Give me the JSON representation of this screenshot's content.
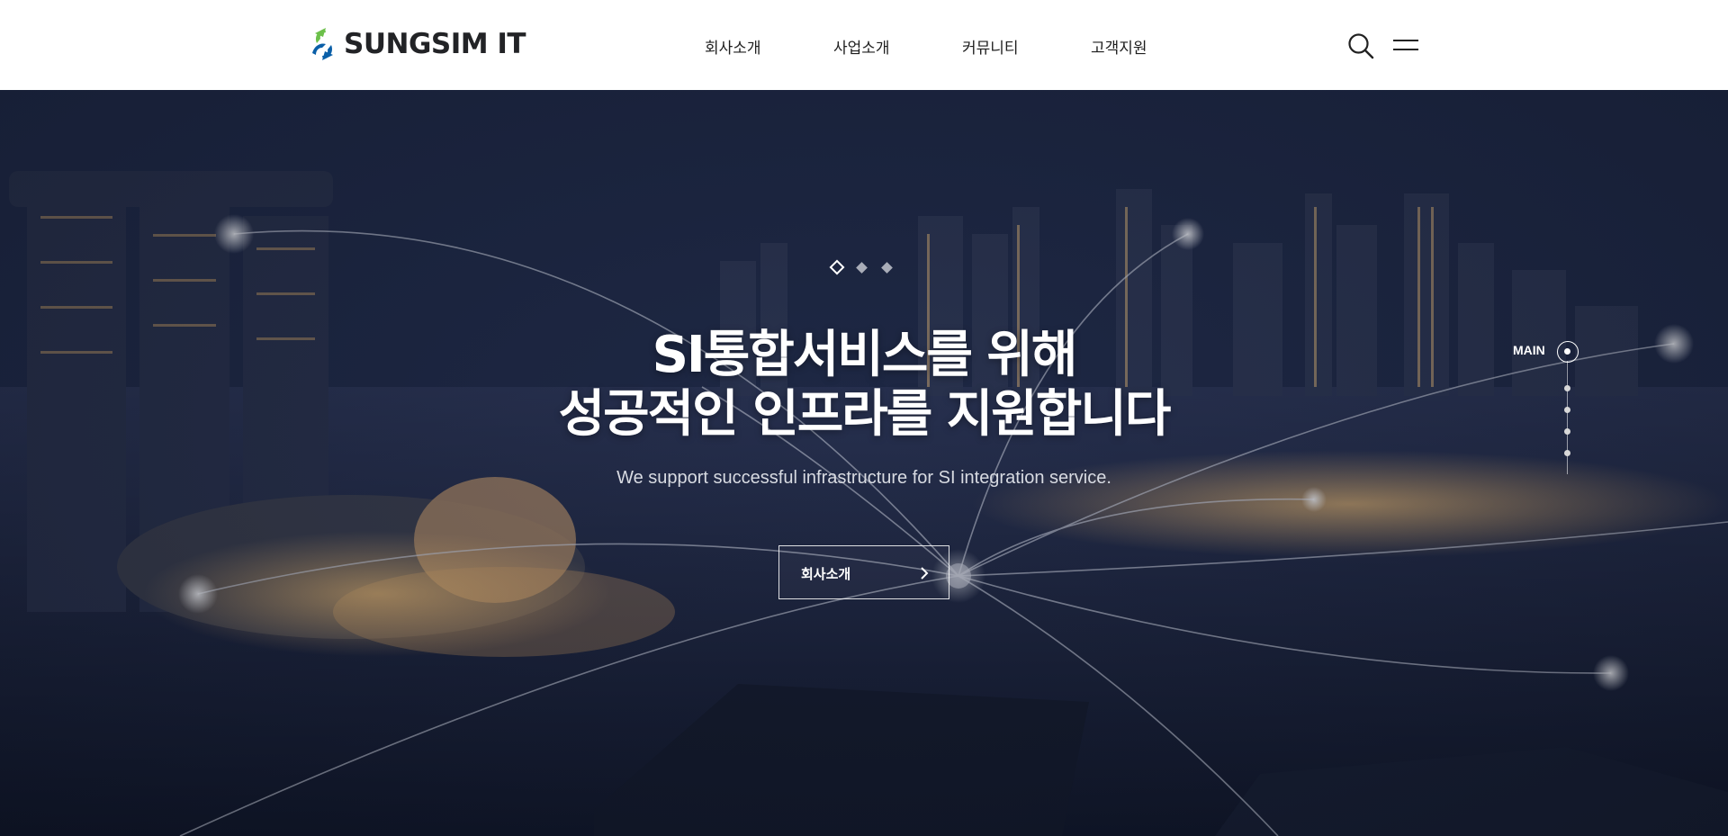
{
  "header": {
    "logo_text": "SUNGSIM IT",
    "nav": [
      "회사소개",
      "사업소개",
      "커뮤니티",
      "고객지원"
    ],
    "search_icon": "search-icon",
    "menu_icon": "hamburger-menu-icon"
  },
  "hero": {
    "title_line1": "SI통합서비스를 위해",
    "title_line2": "성공적인 인프라를 지원합니다",
    "subtitle": "We support successful infrastructure for SI integration service.",
    "cta_label": "회사소개",
    "slides": 3,
    "active_slide": 1
  },
  "side_nav": {
    "label": "MAIN",
    "sections": 5,
    "active_section": 1
  },
  "colors": {
    "header_bg": "#ffffff",
    "logo_green": "#6cc04a",
    "logo_blue": "#0a5fa8",
    "hero_text": "#ffffff"
  }
}
